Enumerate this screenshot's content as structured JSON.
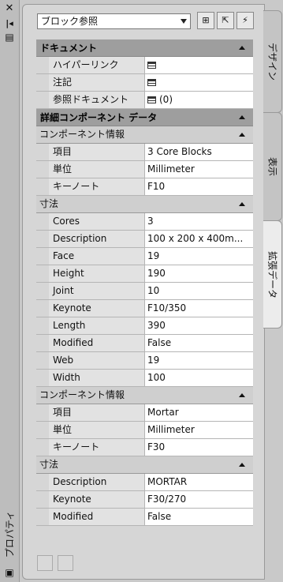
{
  "palette": {
    "title": "プロパティ"
  },
  "toolbar": {
    "style_select": "ブロック参照"
  },
  "tabs": [
    {
      "label": "デザイン"
    },
    {
      "label": "表示"
    },
    {
      "label": "拡張データ"
    }
  ],
  "documentation": {
    "header": "ドキュメント",
    "rows": [
      {
        "key": "ハイパーリンク",
        "value": ""
      },
      {
        "key": "注記",
        "value": ""
      },
      {
        "key": "参照ドキュメント",
        "value": "(0)"
      }
    ]
  },
  "detail": {
    "header": "詳細コンポーネント データ",
    "groups": [
      {
        "info_header": "コンポーネント情報",
        "info_rows": [
          {
            "key": "項目",
            "value": "3 Core Blocks"
          },
          {
            "key": "単位",
            "value": "Millimeter"
          },
          {
            "key": "キーノート",
            "value": "F10"
          }
        ],
        "dim_header": "寸法",
        "dim_rows": [
          {
            "key": "Cores",
            "value": "3"
          },
          {
            "key": "Description",
            "value": "100 x 200 x 400m..."
          },
          {
            "key": "Face",
            "value": "19"
          },
          {
            "key": "Height",
            "value": "190"
          },
          {
            "key": "Joint",
            "value": "10"
          },
          {
            "key": "Keynote",
            "value": "F10/350"
          },
          {
            "key": "Length",
            "value": "390"
          },
          {
            "key": "Modified",
            "value": "False"
          },
          {
            "key": "Web",
            "value": "19"
          },
          {
            "key": "Width",
            "value": "100"
          }
        ]
      },
      {
        "info_header": "コンポーネント情報",
        "info_rows": [
          {
            "key": "項目",
            "value": "Mortar"
          },
          {
            "key": "単位",
            "value": "Millimeter"
          },
          {
            "key": "キーノート",
            "value": "F30"
          }
        ],
        "dim_header": "寸法",
        "dim_rows": [
          {
            "key": "Description",
            "value": "MORTAR"
          },
          {
            "key": "Keynote",
            "value": "F30/270"
          },
          {
            "key": "Modified",
            "value": "False"
          }
        ]
      }
    ]
  }
}
